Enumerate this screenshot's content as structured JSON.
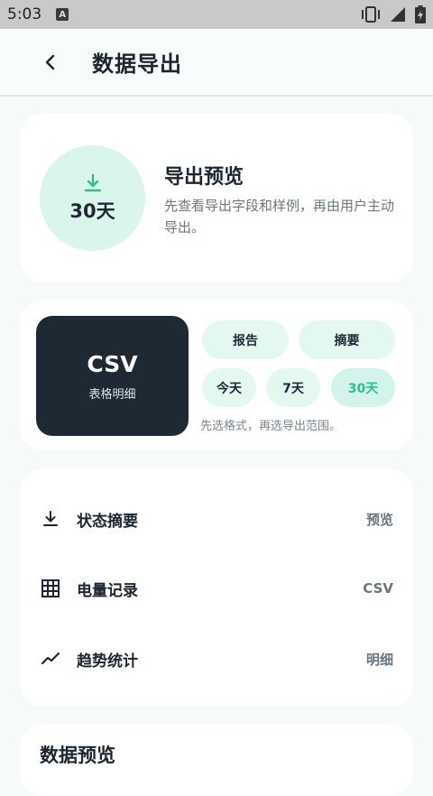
{
  "status_bar": {
    "time": "5:03",
    "notification_letter": "A"
  },
  "header": {
    "title": "数据导出",
    "back_icon": "chevron-left-icon"
  },
  "preview": {
    "range": "30天",
    "title": "导出预览",
    "description": "先查看导出字段和样例，再由用户主动导出。",
    "icon": "download-icon",
    "accent": "#2dbd93"
  },
  "format": {
    "selected_title": "CSV",
    "selected_subtitle": "表格明细",
    "formats": [
      "报告",
      "摘要"
    ],
    "ranges": [
      "今天",
      "7天",
      "30天"
    ],
    "selected_range": "30天",
    "hint": "先选格式，再选导出范围。"
  },
  "fields": [
    {
      "label": "状态摘要",
      "value": "预览",
      "icon": "download-icon"
    },
    {
      "label": "电量记录",
      "value": "CSV",
      "icon": "grid-icon"
    },
    {
      "label": "趋势统计",
      "value": "明细",
      "icon": "trend-icon"
    }
  ],
  "data_preview": {
    "title": "数据预览"
  }
}
